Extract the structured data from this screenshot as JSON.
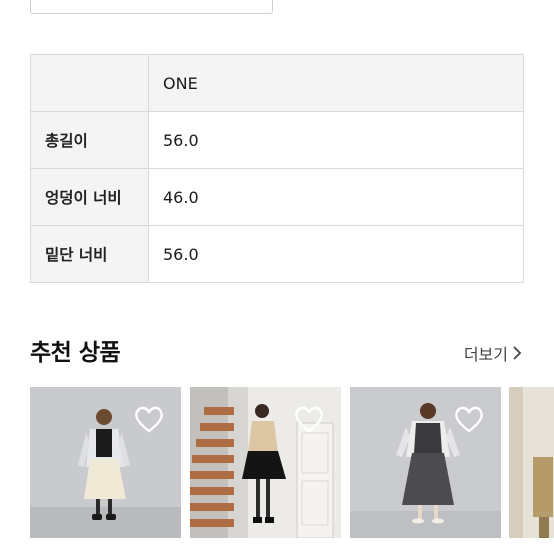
{
  "size_table": {
    "header": {
      "label": "",
      "value": "ONE"
    },
    "rows": [
      {
        "label": "총길이",
        "value": "56.0"
      },
      {
        "label": "엉덩이 너비",
        "value": "46.0"
      },
      {
        "label": "밑단 너비",
        "value": "56.0"
      }
    ]
  },
  "recommended": {
    "title": "추천 상품",
    "more_label": "더보기",
    "products": [
      {
        "image": "model-in-light-jacket-and-cream-skirt",
        "wishlist_icon": "heart-icon"
      },
      {
        "image": "model-on-staircase-in-beige-top-black-skirt",
        "wishlist_icon": "heart-icon"
      },
      {
        "image": "model-in-vest-and-gray-skirt",
        "wishlist_icon": "heart-icon"
      },
      {
        "image": "partial-product-photo",
        "wishlist_icon": "heart-icon"
      }
    ]
  },
  "colors": {
    "table_border": "#d9d9d9",
    "table_label_bg": "#f4f4f4",
    "photo_wall": "#c9cbcf",
    "stairs_wood": "#b07048"
  }
}
